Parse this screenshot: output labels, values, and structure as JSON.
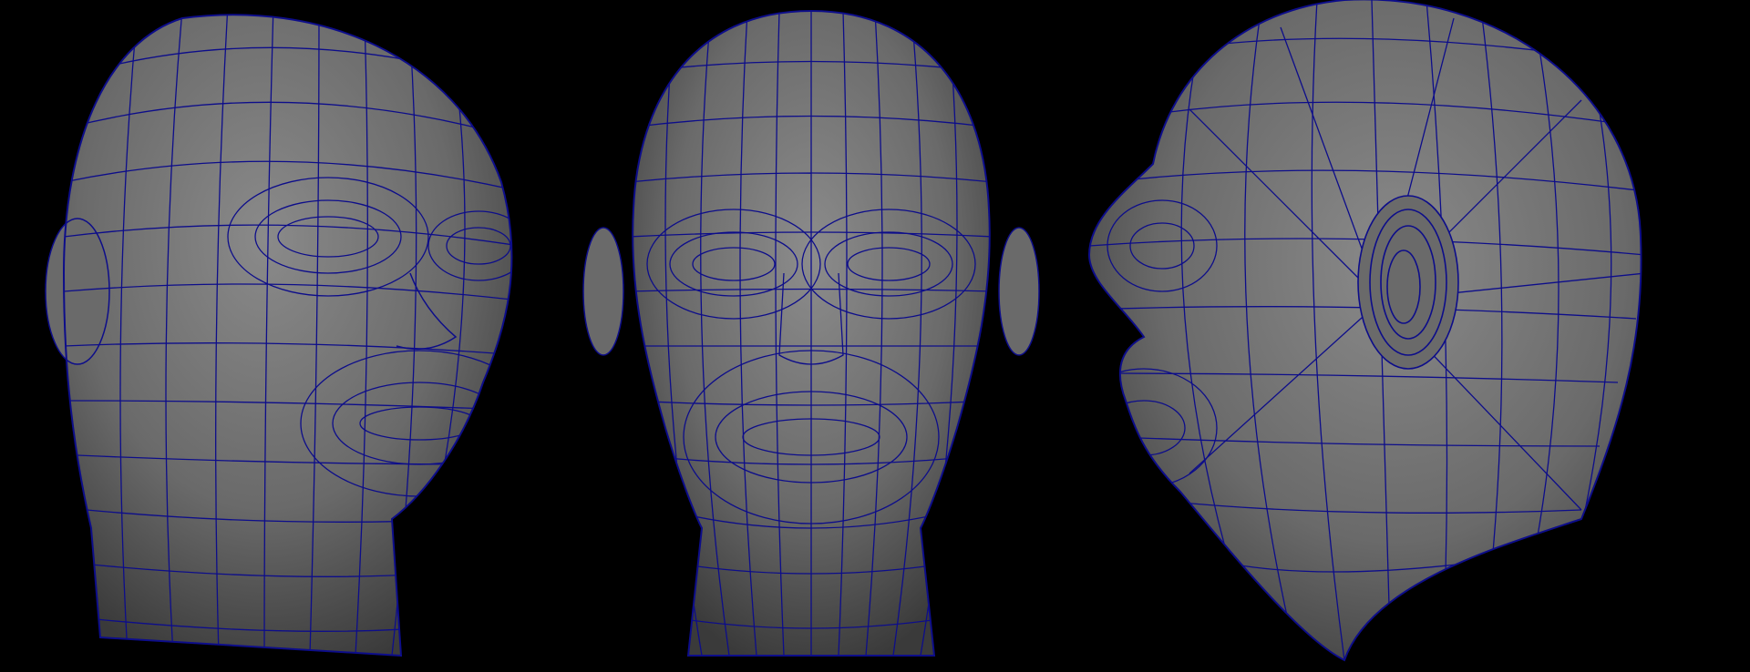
{
  "scene": {
    "background_color": "#000000",
    "surface_color": "#6e6e6e",
    "wireframe_color": "#0d0d8a",
    "views": [
      {
        "name": "three-quarter"
      },
      {
        "name": "front"
      },
      {
        "name": "side"
      }
    ]
  }
}
